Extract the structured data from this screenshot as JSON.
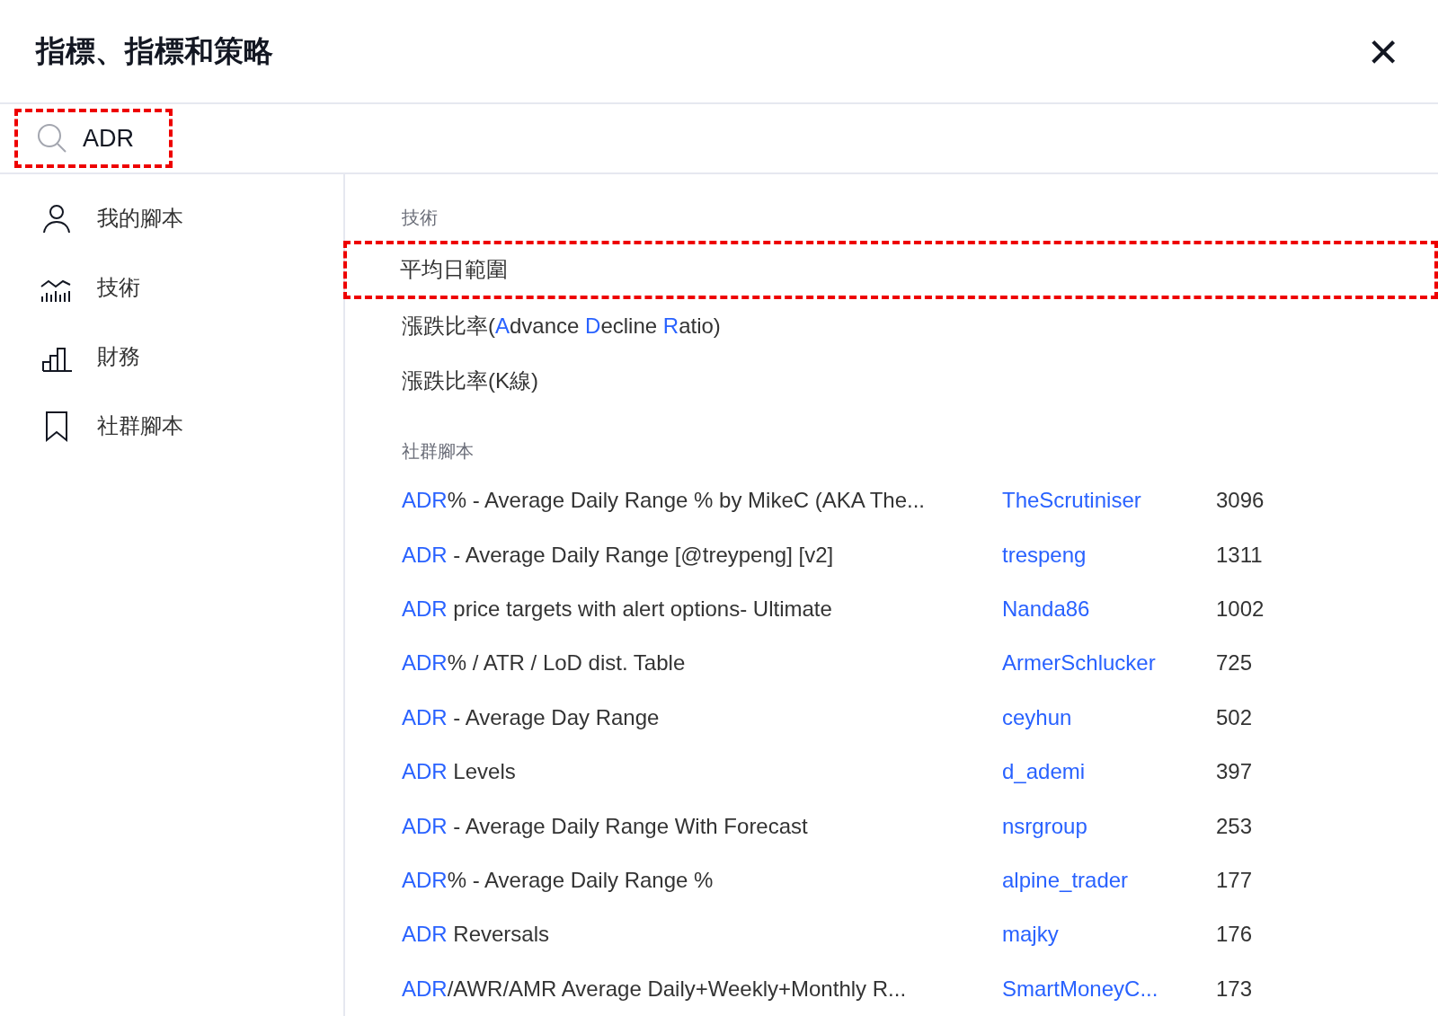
{
  "dialog": {
    "title": "指標、指標和策略",
    "close": "×"
  },
  "search": {
    "value": "ADR",
    "highlighted": true
  },
  "sidebar": {
    "items": [
      {
        "label": "我的腳本",
        "kind": "person",
        "selected": false
      },
      {
        "label": "技術",
        "kind": "chart",
        "selected": false
      },
      {
        "label": "財務",
        "kind": "bars",
        "selected": false
      },
      {
        "label": "社群腳本",
        "kind": "bookmark",
        "selected": false
      }
    ]
  },
  "sections": [
    {
      "heading": "技術",
      "kind": "simple",
      "items": [
        {
          "parts": [
            {
              "text": "平均日範圍",
              "match": false
            }
          ],
          "highlighted": true
        },
        {
          "parts": [
            {
              "text": "漲跌比率(",
              "match": false
            },
            {
              "text": "A",
              "match": true
            },
            {
              "text": "dvance ",
              "match": false
            },
            {
              "text": "D",
              "match": true
            },
            {
              "text": "ecline ",
              "match": false
            },
            {
              "text": "R",
              "match": true
            },
            {
              "text": "atio)",
              "match": false
            }
          ],
          "highlighted": false
        },
        {
          "parts": [
            {
              "text": "漲跌比率(K線)",
              "match": false
            }
          ],
          "highlighted": false
        }
      ]
    },
    {
      "heading": "社群腳本",
      "kind": "scripts",
      "items": [
        {
          "parts": [
            {
              "text": "ADR",
              "match": true
            },
            {
              "text": "% - Average Daily Range % by MikeC (AKA The...",
              "match": false
            }
          ],
          "author": "TheScrutiniser",
          "count": "3096",
          "highlighted": false
        },
        {
          "parts": [
            {
              "text": "ADR",
              "match": true
            },
            {
              "text": " - Average Daily Range [@treypeng] [v2]",
              "match": false
            }
          ],
          "author": "trespeng",
          "count": "1311",
          "highlighted": false
        },
        {
          "parts": [
            {
              "text": "ADR",
              "match": true
            },
            {
              "text": " price targets with alert options- Ultimate",
              "match": false
            }
          ],
          "author": "Nanda86",
          "count": "1002",
          "highlighted": false
        },
        {
          "parts": [
            {
              "text": "ADR",
              "match": true
            },
            {
              "text": "% / ATR / LoD dist. Table",
              "match": false
            }
          ],
          "author": "ArmerSchlucker",
          "count": "725",
          "highlighted": false
        },
        {
          "parts": [
            {
              "text": "ADR",
              "match": true
            },
            {
              "text": " - Average Day Range",
              "match": false
            }
          ],
          "author": "ceyhun",
          "count": "502",
          "highlighted": false
        },
        {
          "parts": [
            {
              "text": "ADR",
              "match": true
            },
            {
              "text": " Levels",
              "match": false
            }
          ],
          "author": "d_ademi",
          "count": "397",
          "highlighted": false
        },
        {
          "parts": [
            {
              "text": "ADR",
              "match": true
            },
            {
              "text": " - Average Daily Range With Forecast",
              "match": false
            }
          ],
          "author": "nsrgroup",
          "count": "253",
          "highlighted": false
        },
        {
          "parts": [
            {
              "text": "ADR",
              "match": true
            },
            {
              "text": "% - Average Daily Range %",
              "match": false
            }
          ],
          "author": "alpine_trader",
          "count": "177",
          "highlighted": false
        },
        {
          "parts": [
            {
              "text": "ADR",
              "match": true
            },
            {
              "text": " Reversals",
              "match": false
            }
          ],
          "author": "majky",
          "count": "176",
          "highlighted": false
        },
        {
          "parts": [
            {
              "text": "ADR",
              "match": true
            },
            {
              "text": "/AWR/AMR Average Daily+Weekly+Monthly R...",
              "match": false
            }
          ],
          "author": "SmartMoneyC...",
          "count": "173",
          "highlighted": false
        }
      ]
    }
  ]
}
